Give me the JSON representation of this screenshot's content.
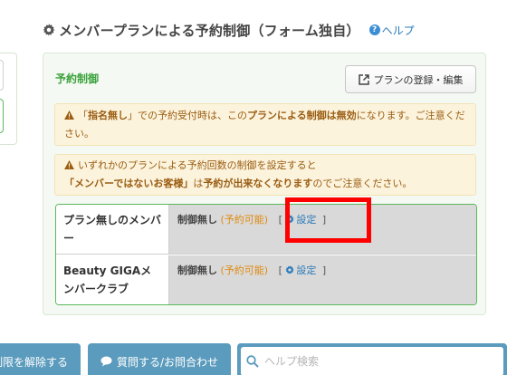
{
  "section": {
    "title": "メンバープランによる予約制御（フォーム独自）",
    "help_label": "ヘルプ"
  },
  "panel": {
    "title": "予約制御",
    "register_button": "プランの登録・編集"
  },
  "warning1": {
    "p1": "「",
    "p2": "指名無し",
    "p3": "」での予約受付時は、この",
    "p4": "プランによる制御は無効",
    "p5": "になります。ご注意ください。"
  },
  "warning2": {
    "line1": "いずれかのプランによる予約回数の制御を設定すると",
    "p1": "「メンバーではないお客様」",
    "p2": "は",
    "p3": "予約が出来なくなります",
    "p4": "のでご注意ください。"
  },
  "table": {
    "rows": [
      {
        "name": "プラン無しのメンバー",
        "status": "制御無し",
        "open": "(",
        "avail": "予約可能",
        "close": ")",
        "bracket_open": "[",
        "link": "設定",
        "bracket_close": "]"
      },
      {
        "name": "Beauty GIGAメンバークラブ",
        "status": "制御無し",
        "open": "(",
        "avail": "予約可能",
        "close": ")",
        "bracket_open": "[",
        "link": "設定",
        "bracket_close": "]"
      }
    ]
  },
  "footer": {
    "left_button": "制限を解除する",
    "contact_button": "質問する/お問合わせ",
    "search_placeholder": "ヘルプ検索"
  },
  "colors": {
    "accent_green": "#3ba23b",
    "link_blue": "#2a7ab8",
    "warning_bg": "#fcf3dc",
    "footer_blue": "#5b9bbd",
    "highlight_red": "#ff0000"
  }
}
